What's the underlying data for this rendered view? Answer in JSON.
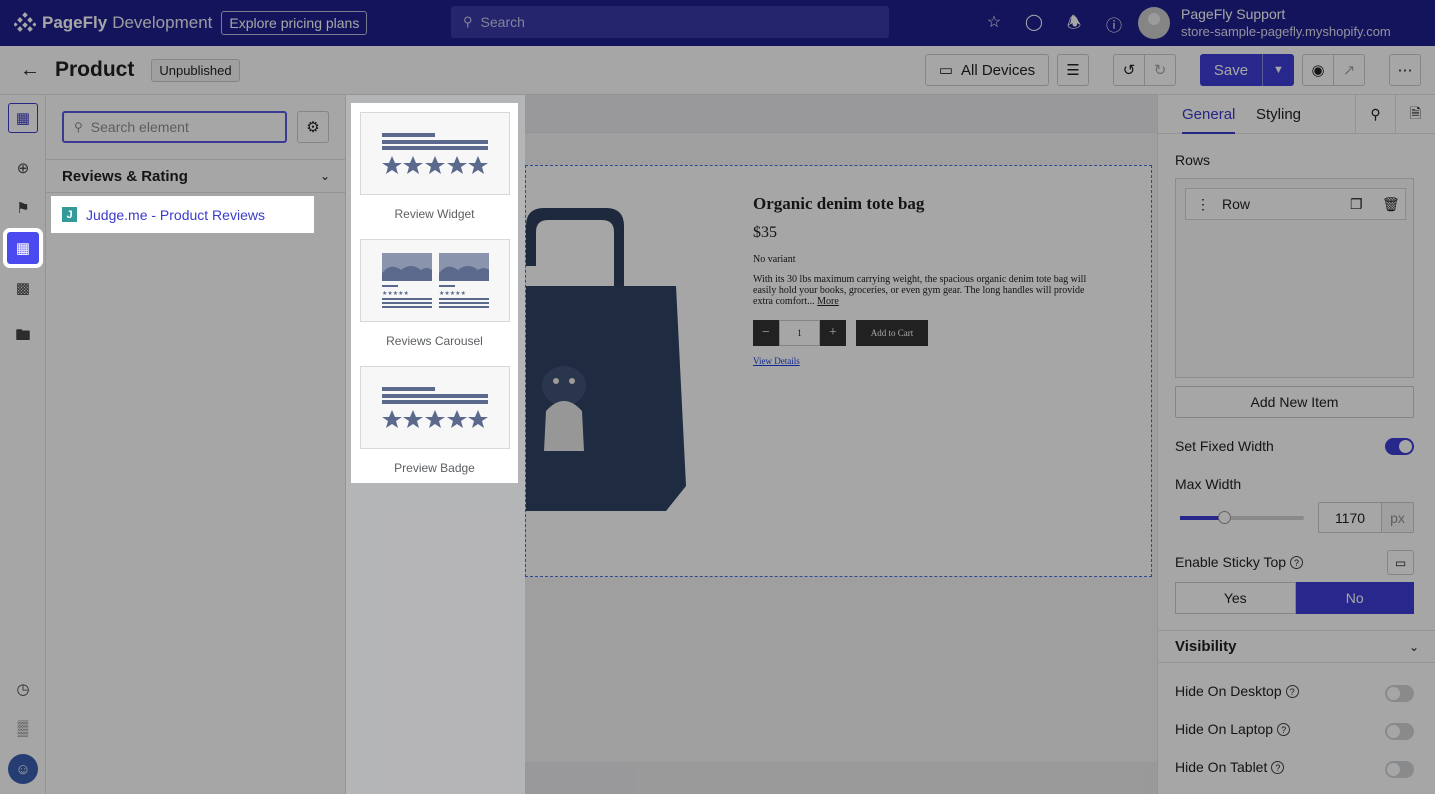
{
  "topbar": {
    "brand": "PageFly",
    "env": "Development",
    "pricing_label": "Explore pricing plans",
    "search_placeholder": "Search",
    "user_name": "PageFly Support",
    "store": "store-sample-pagefly.myshopify.com"
  },
  "header": {
    "title": "Product",
    "status": "Unpublished",
    "devices_label": "All Devices",
    "save_label": "Save"
  },
  "left_panel": {
    "search_placeholder": "Search element",
    "category": "Reviews & Rating",
    "app_item": "Judge.me - Product Reviews"
  },
  "popup": {
    "cards": [
      {
        "label": "Review Widget"
      },
      {
        "label": "Reviews Carousel"
      },
      {
        "label": "Preview Badge"
      }
    ]
  },
  "product": {
    "title": "Organic denim tote bag",
    "price": "$35",
    "variant": "No variant",
    "description": "With its 30 lbs maximum carrying weight, the spacious organic denim tote bag will easily hold your books, groceries, or even gym gear. The long handles will provide extra comfort...",
    "more": "More",
    "qty": "1",
    "add_to_cart": "Add to Cart",
    "view_details": "View Details"
  },
  "right_panel": {
    "tab_general": "General",
    "tab_styling": "Styling",
    "rows_label": "Rows",
    "row_item": "Row",
    "add_item": "Add New Item",
    "fixed_width": "Set Fixed Width",
    "max_width": "Max Width",
    "max_width_value": "1170",
    "unit": "px",
    "sticky": "Enable Sticky Top",
    "yes": "Yes",
    "no": "No",
    "visibility": "Visibility",
    "hide_desktop": "Hide On Desktop",
    "hide_laptop": "Hide On Laptop",
    "hide_tablet": "Hide On Tablet"
  },
  "colors": {
    "topbar": "#202090",
    "accent": "#3e3ed8"
  }
}
